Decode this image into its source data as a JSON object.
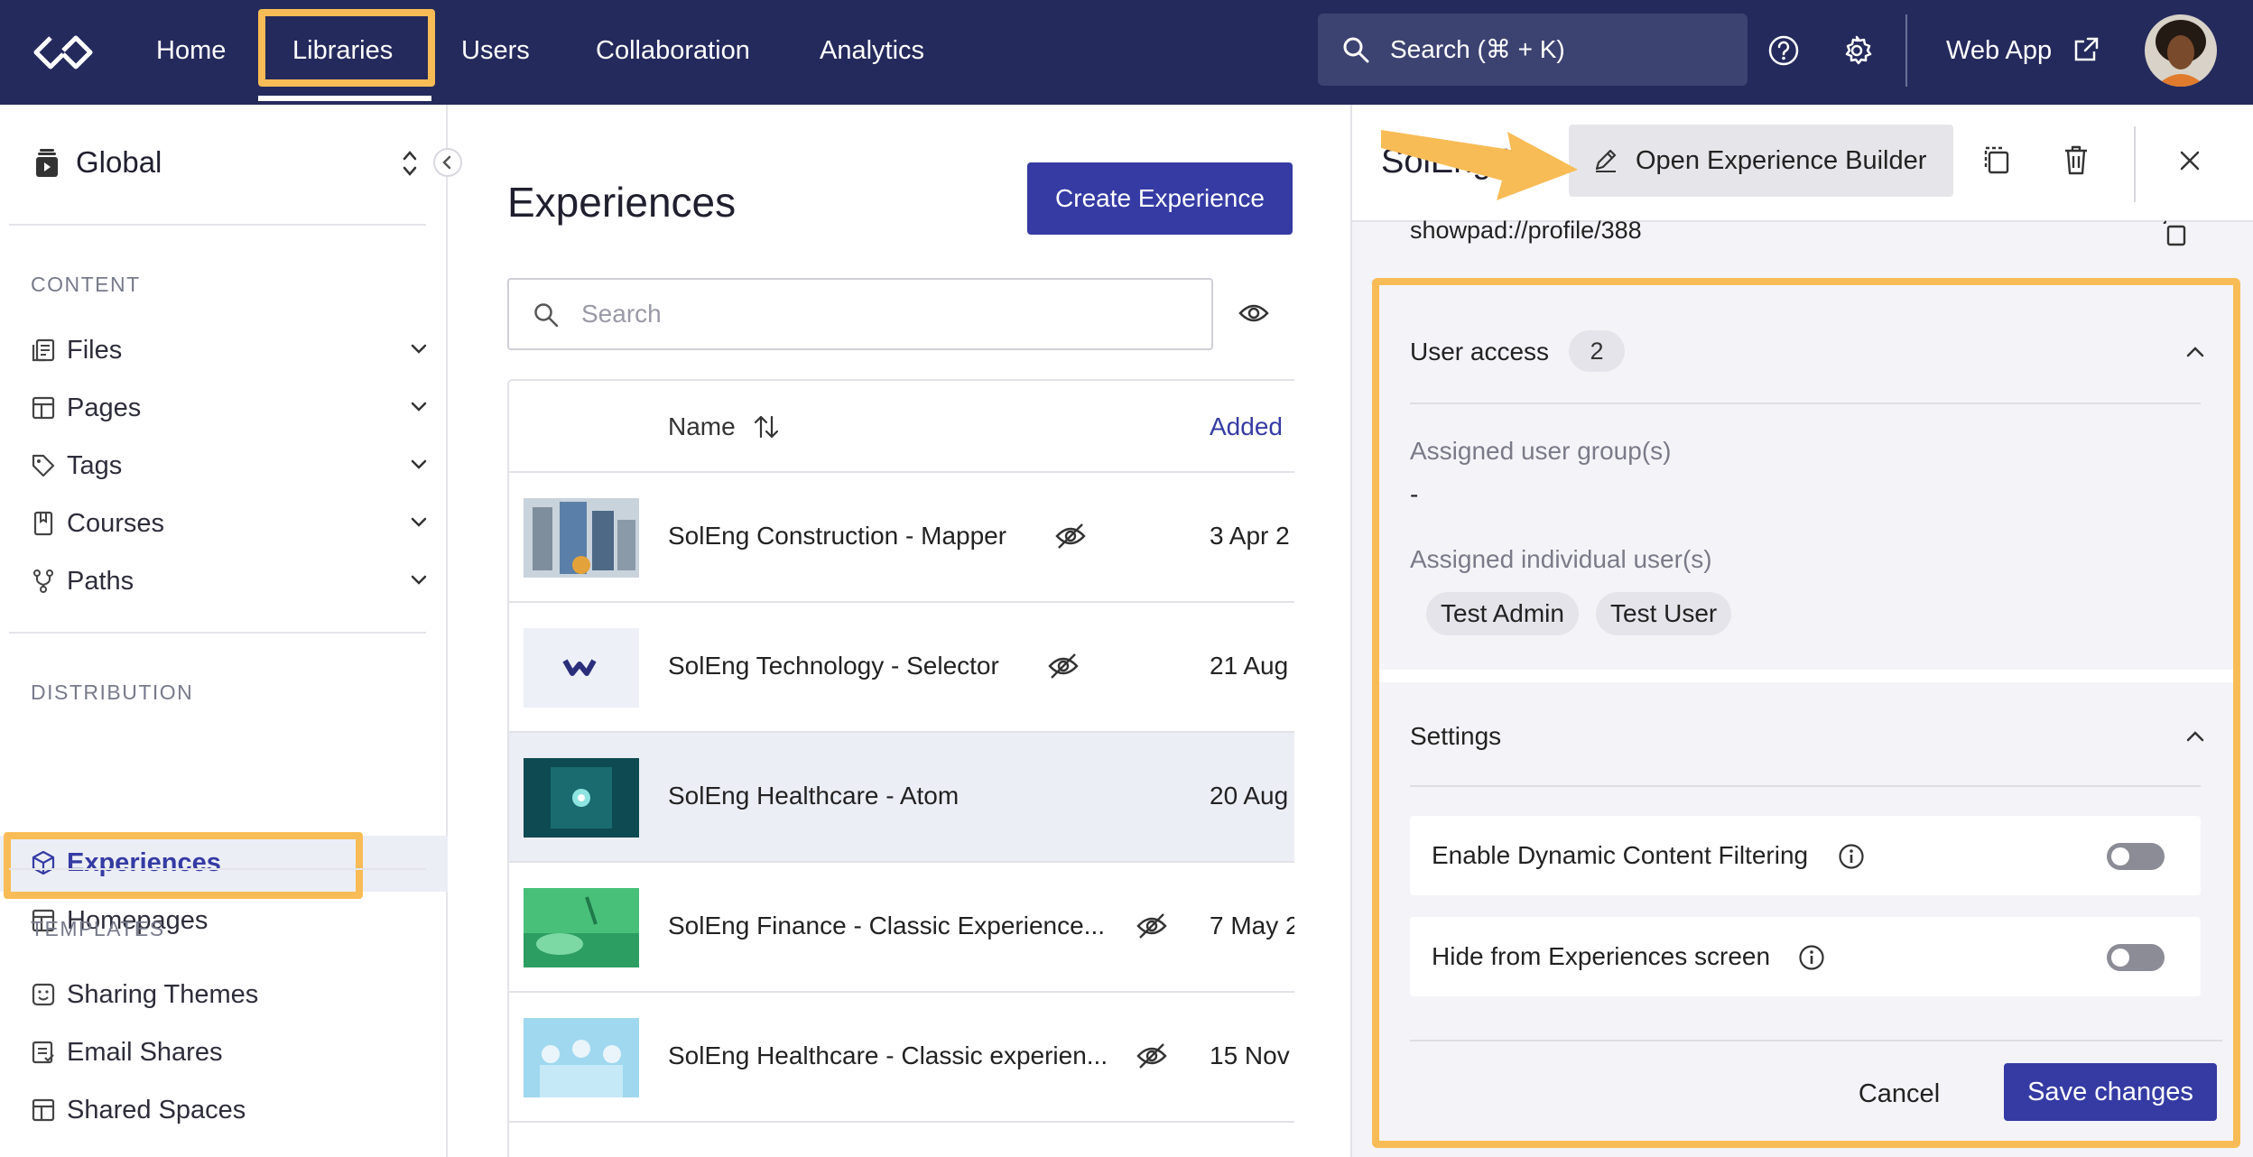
{
  "topbar": {
    "nav": [
      "Home",
      "Libraries",
      "Users",
      "Collaboration",
      "Analytics"
    ],
    "active_nav": "Libraries",
    "search_label": "Search (⌘ + K)",
    "web_app_label": "Web App",
    "icons": [
      "logo-icon",
      "search-icon",
      "help-icon",
      "gear-icon",
      "external-link-icon",
      "avatar"
    ],
    "colors": {
      "background": "#242a5c",
      "highlight": "#f8bc56"
    }
  },
  "sidebar": {
    "scope_label": "Global",
    "content_section": "CONTENT",
    "content_items": [
      {
        "label": "Files",
        "icon": "files-icon"
      },
      {
        "label": "Pages",
        "icon": "pages-icon"
      },
      {
        "label": "Tags",
        "icon": "tag-icon"
      },
      {
        "label": "Courses",
        "icon": "book-icon"
      },
      {
        "label": "Paths",
        "icon": "paths-icon"
      }
    ],
    "distribution_section": "DISTRIBUTION",
    "distribution_items": [
      {
        "label": "Experiences",
        "icon": "cube-icon",
        "active": true
      },
      {
        "label": "Homepages",
        "icon": "layout-icon",
        "active": false
      }
    ],
    "templates_section": "TEMPLATES",
    "template_items": [
      {
        "label": "Sharing Themes",
        "icon": "theme-icon"
      },
      {
        "label": "Email Shares",
        "icon": "email-icon"
      },
      {
        "label": "Shared Spaces",
        "icon": "layout-icon"
      }
    ]
  },
  "main": {
    "title": "Experiences",
    "create_button": "Create Experience",
    "search_placeholder": "Search",
    "columns": {
      "name": "Name",
      "added": "Added"
    },
    "rows": [
      {
        "name": "SolEng Construction - Mapper",
        "date": "3 Apr 2",
        "hidden": true,
        "selected": false
      },
      {
        "name": "SolEng Technology - Selector",
        "date": "21 Aug",
        "hidden": true,
        "selected": false
      },
      {
        "name": "SolEng Healthcare - Atom",
        "date": "20 Aug",
        "hidden": false,
        "selected": true
      },
      {
        "name": "SolEng Finance - Classic Experience...",
        "date": "7 May 2",
        "hidden": true,
        "selected": false
      },
      {
        "name": "SolEng Healthcare - Classic experien...",
        "date": "15 Nov",
        "hidden": true,
        "selected": false
      }
    ]
  },
  "panel": {
    "title": "SolEng H...",
    "open_builder": "Open Experience Builder",
    "profile_url": "showpad://profile/388",
    "user_access": {
      "title": "User access",
      "count": "2",
      "groups_label": "Assigned user group(s)",
      "groups_value": "-",
      "users_label": "Assigned individual user(s)",
      "users": [
        "Test Admin",
        "Test User"
      ]
    },
    "settings": {
      "title": "Settings",
      "options": [
        {
          "label": "Enable Dynamic Content Filtering",
          "enabled": false
        },
        {
          "label": "Hide from Experiences screen",
          "enabled": false
        }
      ]
    },
    "cancel": "Cancel",
    "save": "Save changes"
  }
}
